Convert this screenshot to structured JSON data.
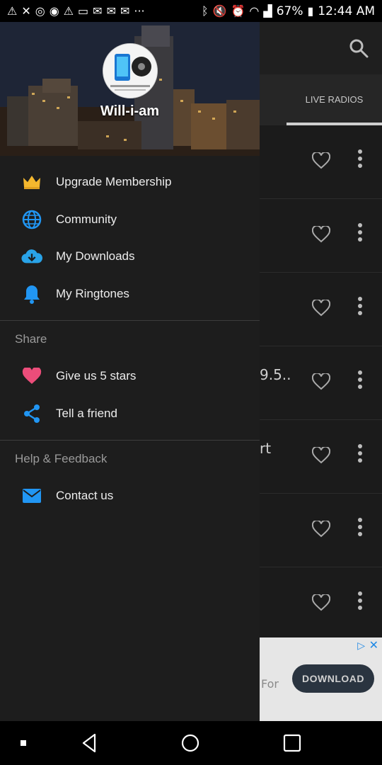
{
  "status_bar": {
    "battery": "67%",
    "time": "12:44 AM"
  },
  "app": {
    "tab_live_radios": "LIVE RADIOS",
    "rows": [
      "",
      "",
      "",
      "9.5..",
      "rt",
      "",
      ""
    ],
    "ad": {
      "text_fragment": "For",
      "download_label": "DOWNLOAD"
    }
  },
  "drawer": {
    "username": "Will-i-am",
    "items": [
      {
        "label": "Upgrade Membership",
        "icon": "crown-icon",
        "color": "#f5b82e"
      },
      {
        "label": "Community",
        "icon": "globe-icon",
        "color": "#2196f3"
      },
      {
        "label": "My Downloads",
        "icon": "cloud-download-icon",
        "color": "#29a3e8"
      },
      {
        "label": "My Ringtones",
        "icon": "bell-icon",
        "color": "#2196f3"
      }
    ],
    "share_section": {
      "title": "Share",
      "items": [
        {
          "label": "Give us 5 stars",
          "icon": "heart-icon",
          "color": "#ec4d7a"
        },
        {
          "label": "Tell a friend",
          "icon": "share-icon",
          "color": "#2196f3"
        }
      ]
    },
    "help_section": {
      "title": "Help & Feedback",
      "items": [
        {
          "label": "Contact us",
          "icon": "mail-icon",
          "color": "#2196f3"
        }
      ]
    }
  }
}
